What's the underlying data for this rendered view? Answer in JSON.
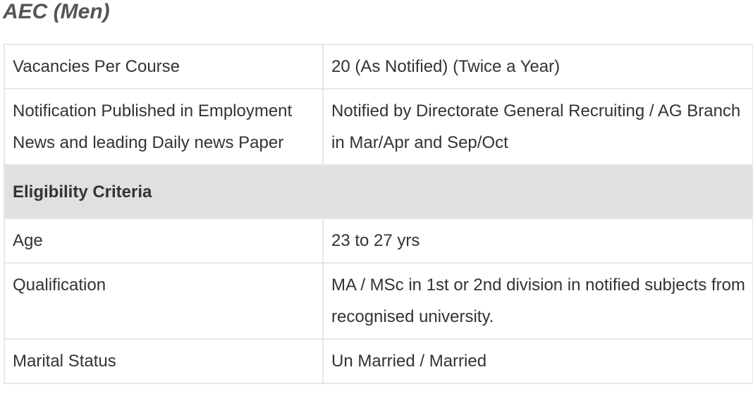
{
  "heading": "AEC (Men)",
  "rows": [
    {
      "label": "Vacancies Per Course",
      "value": "20 (As Notified) (Twice a Year)"
    },
    {
      "label": "Notification Published in Employment News and leading Daily news Paper",
      "value": "Notified by Directorate General Recruiting / AG Branch in Mar/Apr and Sep/Oct"
    }
  ],
  "section": {
    "title": "Eligibility Criteria"
  },
  "criteria": [
    {
      "label": "Age",
      "value": "23 to 27 yrs"
    },
    {
      "label": "Qualification",
      "value": "MA / MSc in 1st or 2nd division in notified subjects from recognised university."
    },
    {
      "label": "Marital Status",
      "value": "Un Married / Married"
    }
  ]
}
